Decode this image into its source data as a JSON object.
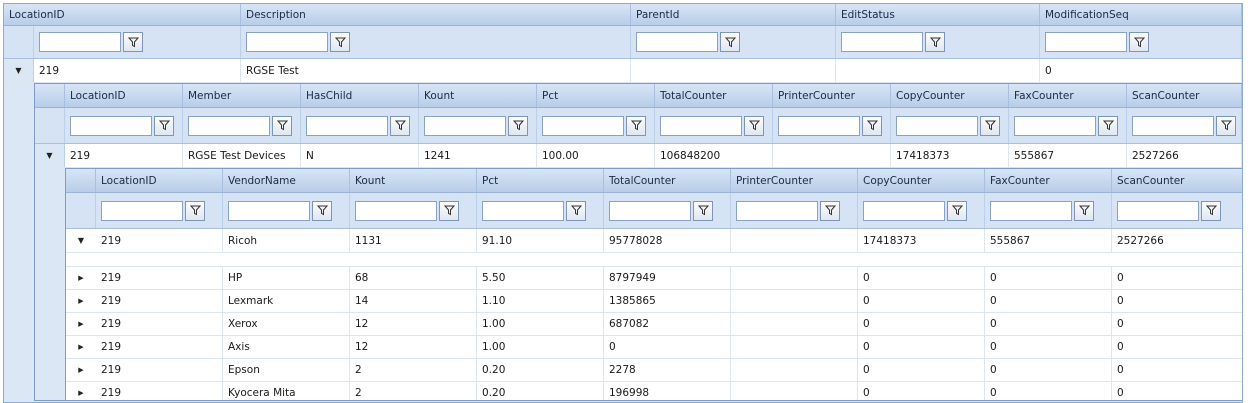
{
  "level1": {
    "columns": [
      "LocationID",
      "Description",
      "ParentId",
      "EditStatus",
      "ModificationSeq"
    ],
    "row": [
      "219",
      "RGSE Test",
      "",
      "",
      "0"
    ]
  },
  "level2": {
    "columns": [
      "LocationID",
      "Member",
      "HasChild",
      "Kount",
      "Pct",
      "TotalCounter",
      "PrinterCounter",
      "CopyCounter",
      "FaxCounter",
      "ScanCounter"
    ],
    "row": [
      "219",
      "RGSE Test Devices",
      "N",
      "1241",
      "100.00",
      "106848200",
      "",
      "17418373",
      "555867",
      "2527266"
    ]
  },
  "level3": {
    "columns": [
      "LocationID",
      "VendorName",
      "Kount",
      "Pct",
      "TotalCounter",
      "PrinterCounter",
      "CopyCounter",
      "FaxCounter",
      "ScanCounter"
    ],
    "expanded_row": [
      "219",
      "Ricoh",
      "1131",
      "91.10",
      "95778028",
      "",
      "17418373",
      "555867",
      "2527266"
    ],
    "rows": [
      [
        "219",
        "HP",
        "68",
        "5.50",
        "8797949",
        "",
        "0",
        "0",
        "0"
      ],
      [
        "219",
        "Lexmark",
        "14",
        "1.10",
        "1385865",
        "",
        "0",
        "0",
        "0"
      ],
      [
        "219",
        "Xerox",
        "12",
        "1.00",
        "687082",
        "",
        "0",
        "0",
        "0"
      ],
      [
        "219",
        "Axis",
        "12",
        "1.00",
        "0",
        "",
        "0",
        "0",
        "0"
      ],
      [
        "219",
        "Epson",
        "2",
        "0.20",
        "2278",
        "",
        "0",
        "0",
        "0"
      ],
      [
        "219",
        "Kyocera Mita",
        "2",
        "0.20",
        "196998",
        "",
        "0",
        "0",
        "0"
      ]
    ]
  },
  "icons": {
    "filter": "filter-funnel-icon",
    "expanded": "triangle-down-icon",
    "collapsed": "triangle-right-icon"
  }
}
